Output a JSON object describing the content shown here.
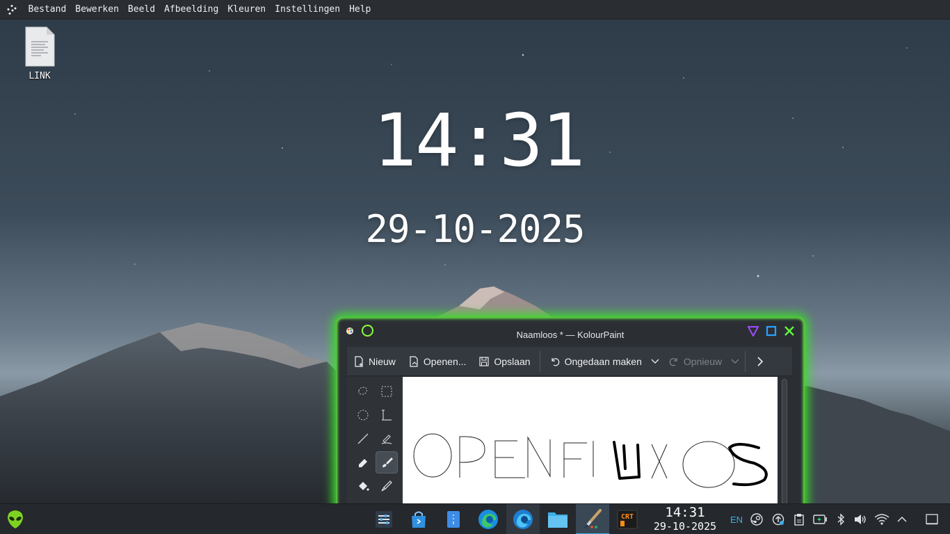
{
  "menubar": {
    "items": [
      "Bestand",
      "Bewerken",
      "Beeld",
      "Afbeelding",
      "Kleuren",
      "Instellingen",
      "Help"
    ]
  },
  "desktop": {
    "icons": [
      {
        "label": "LINK",
        "icon": "text-document-icon"
      }
    ]
  },
  "clock_widget": {
    "time": "14:31",
    "date": "29-10-2025"
  },
  "window": {
    "title": "Naamloos * — KolourPaint",
    "toolbar": {
      "new": "Nieuw",
      "open": "Openen...",
      "save": "Opslaan",
      "undo": "Ongedaan maken",
      "redo": "Opnieuw"
    },
    "tools": [
      "free-form-select",
      "rectangular-select",
      "elliptical-select",
      "text",
      "line",
      "pen",
      "eraser",
      "brush",
      "flood-fill",
      "color-picker"
    ],
    "active_tool": "brush",
    "accent_color": "#3bdc2a"
  },
  "taskbar": {
    "apps": [
      "system-settings",
      "discover-store",
      "document-viewer",
      "edge-browser",
      "edge-beta-browser",
      "file-manager",
      "kolourpaint",
      "crt-terminal"
    ],
    "active_app": "kolourpaint",
    "clock_time": "14:31",
    "clock_date": "29-10-2025",
    "language": "EN",
    "tray_icons": [
      "steam-icon",
      "update-icon",
      "clipboard-icon",
      "battery-icon",
      "bluetooth-icon",
      "volume-icon",
      "wifi-icon",
      "expand-tray-icon",
      "show-desktop-icon"
    ]
  }
}
